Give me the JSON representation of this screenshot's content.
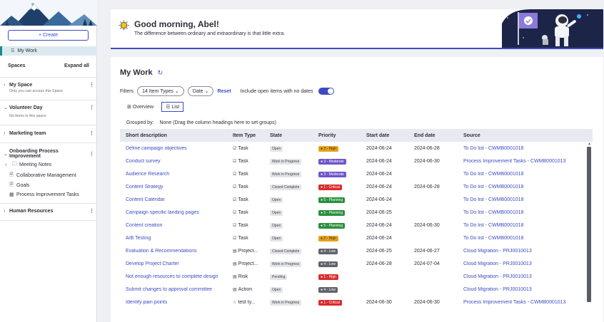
{
  "sidebar": {
    "create_label": "+ Create",
    "my_work_label": "My Work",
    "spaces_title": "Spaces",
    "expand_all": "Expand all",
    "spaces": [
      {
        "name": "My Space",
        "sub": "Only you can access this Space",
        "expanded": false
      },
      {
        "name": "Volunteer Day",
        "sub": "No items in this space",
        "expanded": true
      },
      {
        "name": "Marketing team",
        "sub": "",
        "expanded": false
      },
      {
        "name": "Onboarding Process Improvement",
        "sub": "",
        "expanded": true
      },
      {
        "name": "Human Resources",
        "sub": "",
        "expanded": false
      }
    ],
    "onboarding_items": [
      "Meeting Notes",
      "Collaborative Management",
      "Goals",
      "Process Improvement Tasks"
    ]
  },
  "banner": {
    "greeting": "Good morning, Abel!",
    "quote": "The difference between ordinary and extraordinary is that little extra."
  },
  "main": {
    "title": "My Work",
    "filters_label": "Filters",
    "item_types": "14 Item Types",
    "date": "Date",
    "reset": "Reset",
    "include_label": "Include open items with no dates",
    "tabs": [
      "Overview",
      "List"
    ],
    "grouped_label": "Grouped by:",
    "grouped_value": "None (Drag the column headings here to set groups)",
    "columns": [
      "Short description",
      "Item Type",
      "State",
      "Priority",
      "Start date",
      "End date",
      "Source"
    ],
    "rows": [
      {
        "desc": "Define campaign objectives",
        "type": "Task",
        "state": "Open",
        "priority": "2 - High",
        "start": "2024-06-24",
        "end": "2024-06-28",
        "source": "To Do list - CWMB0001018"
      },
      {
        "desc": "Conduct survey",
        "type": "Task",
        "state": "Work in Progress",
        "priority": "3 - Moderate",
        "start": "2024-06-24",
        "end": "2024-06-30",
        "source": "Process Improvement Tasks - CWMB0001013"
      },
      {
        "desc": "Audience Research",
        "type": "Task",
        "state": "Work in Progress",
        "priority": "3 - Moderate",
        "start": "2024-06-24",
        "end": "",
        "source": "To Do list - CWMB0001018"
      },
      {
        "desc": "Content Strategy",
        "type": "Task",
        "state": "Closed Complete",
        "priority": "1 - Critical",
        "start": "2024-06-24",
        "end": "2024-06-28",
        "source": "To Do list - CWMB0001018"
      },
      {
        "desc": "Content Calendar",
        "type": "Task",
        "state": "Open",
        "priority": "5 - Planning",
        "start": "2024-06-24",
        "end": "",
        "source": "To Do list - CWMB0001018"
      },
      {
        "desc": "Campaign specific landing pages",
        "type": "Task",
        "state": "Open",
        "priority": "5 - Planning",
        "start": "2024-06-25",
        "end": "",
        "source": "To Do list - CWMB0001018"
      },
      {
        "desc": "Content creation",
        "type": "Task",
        "state": "Open",
        "priority": "5 - Planning",
        "start": "2024-06-24",
        "end": "2024-06-30",
        "source": "To Do list - CWMB0001018"
      },
      {
        "desc": "A/B Testing",
        "type": "Task",
        "state": "Open",
        "priority": "2 - High",
        "start": "2024-06-24",
        "end": "",
        "source": "To Do list - CWMB0001018"
      },
      {
        "desc": "Evaluation & Recommendations",
        "type": "Project...",
        "state": "Closed Complete",
        "priority": "4 - Low",
        "start": "2024-06-25",
        "end": "2024-06-27",
        "source": "Cloud Migration - PRJ0010013"
      },
      {
        "desc": "Develop Project Charter",
        "type": "Project...",
        "state": "Work in Progress",
        "priority": "4 - Low",
        "start": "2024-06-28",
        "end": "2024-07-04",
        "source": "Cloud Migration - PRJ0010013"
      },
      {
        "desc": "Not enough resources to complete design",
        "type": "Risk",
        "state": "Pending",
        "priority": "1 - High",
        "start": "",
        "end": "",
        "source": "Cloud Migration - PRJ0010013"
      },
      {
        "desc": "Submit changes to approval committee",
        "type": "Action",
        "state": "Open",
        "priority": "4 - Low",
        "start": "",
        "end": "",
        "source": "Cloud Migration - PRJ0010013"
      },
      {
        "desc": "Identify pain points",
        "type": "test ty...",
        "state": "Work in Progress",
        "priority": "1 - Critical",
        "start": "2024-06-30",
        "end": "2024-06-30",
        "source": "Process Improvement Tasks - CWMB0001013"
      }
    ]
  },
  "colors": {
    "accent": "#3b4cc0",
    "priority_high": "#e8a317",
    "priority_moderate": "#6f55c9",
    "priority_critical": "#d92c2c",
    "priority_planning": "#2a8f3d",
    "priority_low": "#5f636c"
  }
}
